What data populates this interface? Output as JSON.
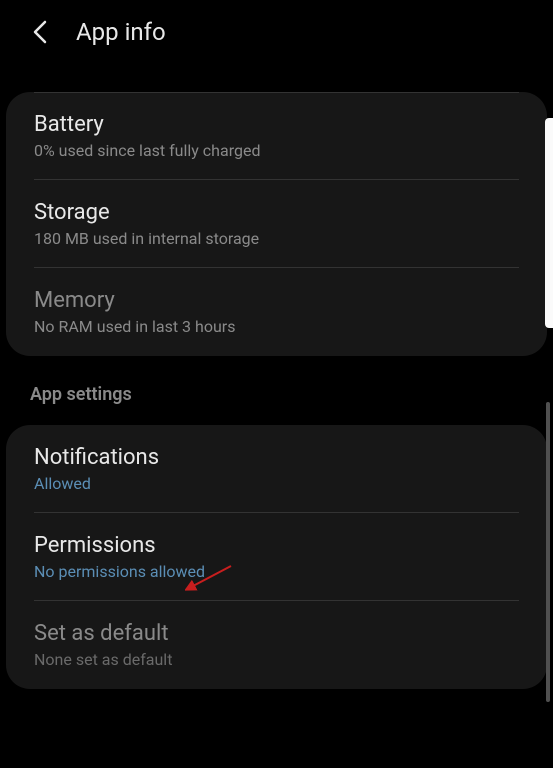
{
  "header": {
    "title": "App info"
  },
  "usage_section": {
    "battery": {
      "title": "Battery",
      "subtitle": "0% used since last fully charged"
    },
    "storage": {
      "title": "Storage",
      "subtitle": "180 MB used in internal storage"
    },
    "memory": {
      "title": "Memory",
      "subtitle": "No RAM used in last 3 hours"
    }
  },
  "settings_section": {
    "header": "App settings",
    "notifications": {
      "title": "Notifications",
      "subtitle": "Allowed"
    },
    "permissions": {
      "title": "Permissions",
      "subtitle": "No permissions allowed"
    },
    "set_as_default": {
      "title": "Set as default",
      "subtitle": "None set as default"
    }
  }
}
